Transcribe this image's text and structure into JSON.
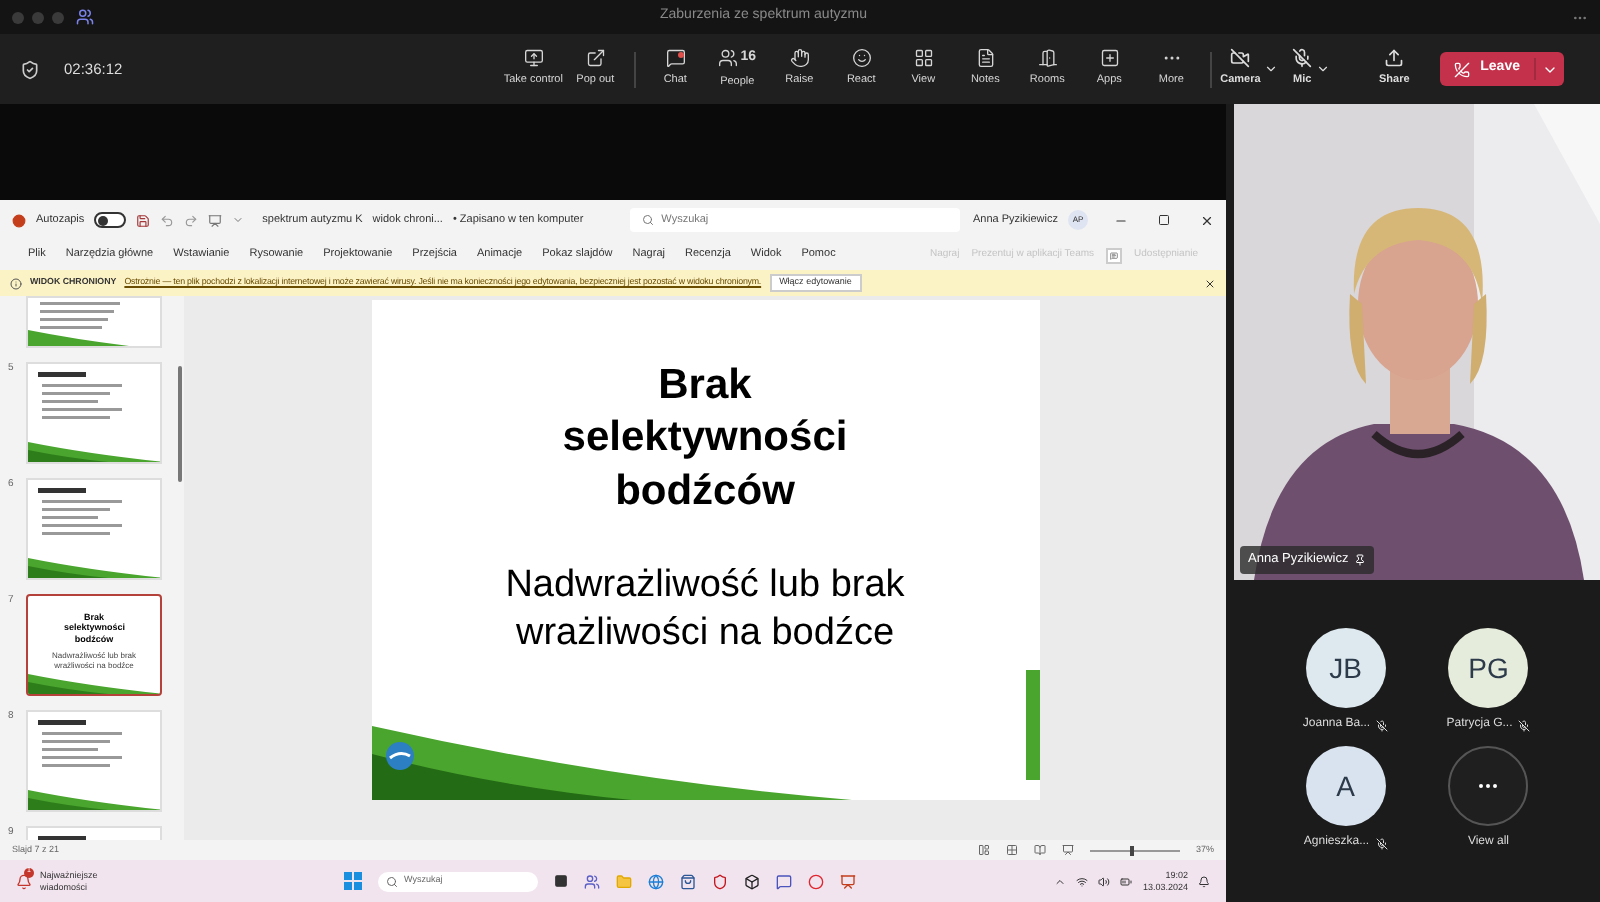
{
  "window": {
    "title": "Zaburzenia ze spektrum autyzmu"
  },
  "meeting_toolbar": {
    "timer": "02:36:12",
    "buttons": [
      {
        "label": "Take control"
      },
      {
        "label": "Pop out"
      },
      {
        "label": "Chat",
        "unread": true
      },
      {
        "label": "People",
        "count": "16"
      },
      {
        "label": "Raise"
      },
      {
        "label": "React"
      },
      {
        "label": "View"
      },
      {
        "label": "Notes"
      },
      {
        "label": "Rooms"
      },
      {
        "label": "Apps"
      },
      {
        "label": "More"
      }
    ],
    "camera": {
      "label": "Camera",
      "on": false
    },
    "mic": {
      "label": "Mic",
      "on": false
    },
    "share": {
      "label": "Share"
    },
    "leave": {
      "label": "Leave"
    }
  },
  "powerpoint": {
    "autosave": {
      "label": "Autozapis",
      "on": false
    },
    "doc_title": [
      "spektrum autyzmu K",
      "widok chroni...",
      "• Zapisano w ten komputer"
    ],
    "search": {
      "placeholder": "Wyszukaj"
    },
    "user": {
      "name": "Anna Pyzikiewicz",
      "initials": "AP"
    },
    "menu": [
      {
        "label": "Plik"
      },
      {
        "label": "Narzędzia główne"
      },
      {
        "label": "Wstawianie"
      },
      {
        "label": "Rysowanie"
      },
      {
        "label": "Projektowanie"
      },
      {
        "label": "Przejścia"
      },
      {
        "label": "Animacje"
      },
      {
        "label": "Pokaz slajdów"
      },
      {
        "label": "Nagraj"
      },
      {
        "label": "Recenzja"
      },
      {
        "label": "Widok"
      },
      {
        "label": "Pomoc"
      }
    ],
    "ribbon_actions": [
      {
        "label": "Nagraj",
        "disabled": true
      },
      {
        "label": "Prezentuj w aplikacji Teams",
        "disabled": true
      },
      {
        "label": "Udostępnianie",
        "disabled": true
      }
    ],
    "banner": {
      "label": "WIDOK CHRONIONY",
      "message": "Ostrożnie — ten plik pochodzi z lokalizacji internetowej i może zawierać wirusy. Jeśli nie ma konieczności jego edytowania, bezpieczniej jest pozostać w widoku chronionym.",
      "button": "Włącz edytowanie"
    },
    "thumbnails": [
      {
        "number": "5",
        "selected": false
      },
      {
        "number": "6",
        "selected": false
      },
      {
        "number": "7",
        "selected": true,
        "title": "Brak selektywności bodźców",
        "body": "Nadwrażliwość lub brak wrażliwości na bodźce"
      },
      {
        "number": "8",
        "selected": false
      },
      {
        "number": "9",
        "selected": false
      }
    ],
    "slide": {
      "title": "Brak selektywności bodźców",
      "body": "Nadwrażliwość lub brak wrażliwości na bodźce"
    },
    "status": {
      "slide_count": "Slajd 7 z 21",
      "zoom": "37%",
      "zoom_level": {
        "level": 0.45
      }
    },
    "taskbar": {
      "news": "Najważniejsze wiadomości",
      "news_badge": "1",
      "search": {
        "placeholder": "Wyszukaj"
      },
      "time": "19:02",
      "date": "13.03.2024"
    }
  },
  "video": {
    "name": "Anna Pyzikiewicz"
  },
  "participants": [
    {
      "initials": "JB",
      "name": "Joanna Ba...",
      "muted": true,
      "color": "#dde9ef"
    },
    {
      "initials": "PG",
      "name": "Patrycja G...",
      "muted": true,
      "color": "#e6ecdc"
    },
    {
      "initials": "A",
      "name": "Agnieszka...",
      "muted": true,
      "color": "#d9e3ef"
    }
  ],
  "view_all": {
    "label": "View all"
  }
}
